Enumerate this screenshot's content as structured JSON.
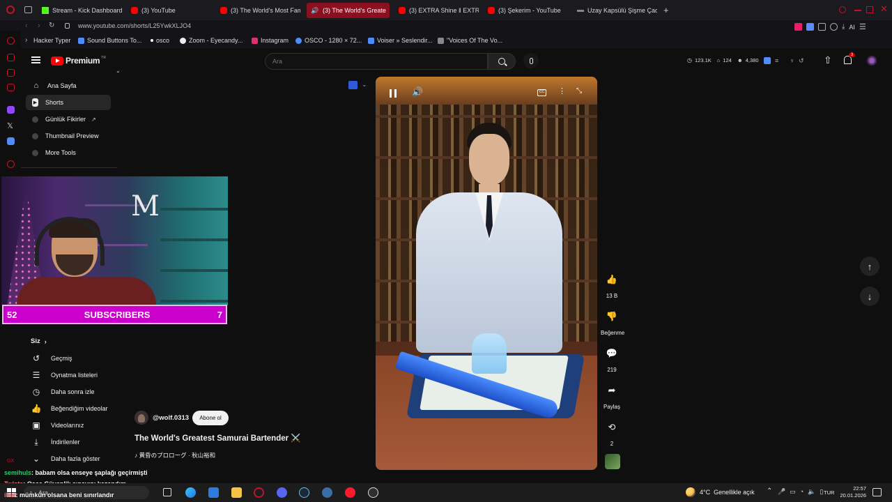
{
  "browser": {
    "tabs": [
      {
        "label": "Stream - Kick Dashboard",
        "color": "#53fc18"
      },
      {
        "label": "(3) YouTube",
        "color": "#ff0000"
      },
      {
        "label": "(3) The World's Most Fam",
        "color": "#ff0000"
      },
      {
        "label": "(3) The World's Greate",
        "color": "#ff0000"
      },
      {
        "label": "(3) EXTRA Shine ‖ EXTR",
        "color": "#ff0000"
      },
      {
        "label": "(3) Şekerim - YouTube",
        "color": "#ff0000"
      },
      {
        "label": "Uzay Kapsülü Şişme Çadır",
        "color": "#888888"
      }
    ],
    "new_tab": "+",
    "url": "www.youtube.com/shorts/L25YwkXLJO4",
    "bookmarks": [
      {
        "label": "Hacker Typer",
        "color": "#2ecc71"
      },
      {
        "label": "Sound Buttons To...",
        "color": "#4e8cff"
      },
      {
        "label": "osco",
        "color": "#ffffff"
      },
      {
        "label": "Zoom - Eyecandy...",
        "color": "#eeeeee"
      },
      {
        "label": "Instagram",
        "color": "#e1306c"
      },
      {
        "label": "OSCO - 1280 × 72...",
        "color": "#4e8cff"
      },
      {
        "label": "Voiser » Seslendir...",
        "color": "#4e8cff"
      },
      {
        "label": "\"Voices Of The Vo...",
        "color": "#aaaaaa"
      }
    ],
    "toolbar_ai": "AI"
  },
  "youtube": {
    "logo_text": "Premium",
    "logo_badge": "TR",
    "search_placeholder": "Ara",
    "stats": {
      "views": "123.1K",
      "likes": "124",
      "subs": "4,380"
    },
    "notifications": "3",
    "nav": [
      {
        "label": "Ana Sayfa",
        "icon": "home-icon"
      },
      {
        "label": "Shorts",
        "icon": "shorts-icon"
      },
      {
        "label": "Günlük Fikirler",
        "icon": "ext-icon"
      },
      {
        "label": "Thumbnail Preview",
        "icon": "ext-icon"
      },
      {
        "label": "More Tools",
        "icon": "ext-icon"
      }
    ],
    "you_section": {
      "title": "Siz",
      "items": [
        {
          "label": "Geçmiş",
          "icon": "history-icon"
        },
        {
          "label": "Oynatma listeleri",
          "icon": "playlist-icon"
        },
        {
          "label": "Daha sonra izle",
          "icon": "clock-icon"
        },
        {
          "label": "Beğendiğim videolar",
          "icon": "like-icon"
        },
        {
          "label": "Videolarınız",
          "icon": "video-icon"
        },
        {
          "label": "İndirilenler",
          "icon": "download-icon"
        },
        {
          "label": "Daha fazla göster",
          "icon": "chevron-down-icon"
        }
      ]
    },
    "short": {
      "channel": "@wolf.0313",
      "subscribe": "Abone ol",
      "title": "The World's Greatest Samurai Bartender ⚔️",
      "music": "♪ 黄昏のプロローグ · 秋山裕和"
    },
    "actions": {
      "likes": "13 B",
      "dislike": "Beğenme",
      "comments": "219",
      "share": "Paylaş",
      "remix": "2"
    }
  },
  "overlay": {
    "subscribers_label": "SUBSCRIBERS",
    "count_left": "52",
    "count_right": "7",
    "chat": [
      {
        "user": "semihuls",
        "text": ": babam olsa enseye şaplağı geçirmişti",
        "user_color": "#2ecc71"
      },
      {
        "user": "Twista",
        "text": ": Osca Güvenlik sınavını kazandım",
        "user_color": "#ff7b7b"
      },
      {
        "user": "iber",
        "text": ": mümkün olsana beni sınırlandır",
        "user_color": "#ff7b7b"
      }
    ],
    "gx_label": "GX"
  },
  "taskbar": {
    "search": "Ara",
    "weather": "4°C  Genellikle açık",
    "lang": "TUR",
    "time": "22:57",
    "date": "20.01.2026"
  }
}
